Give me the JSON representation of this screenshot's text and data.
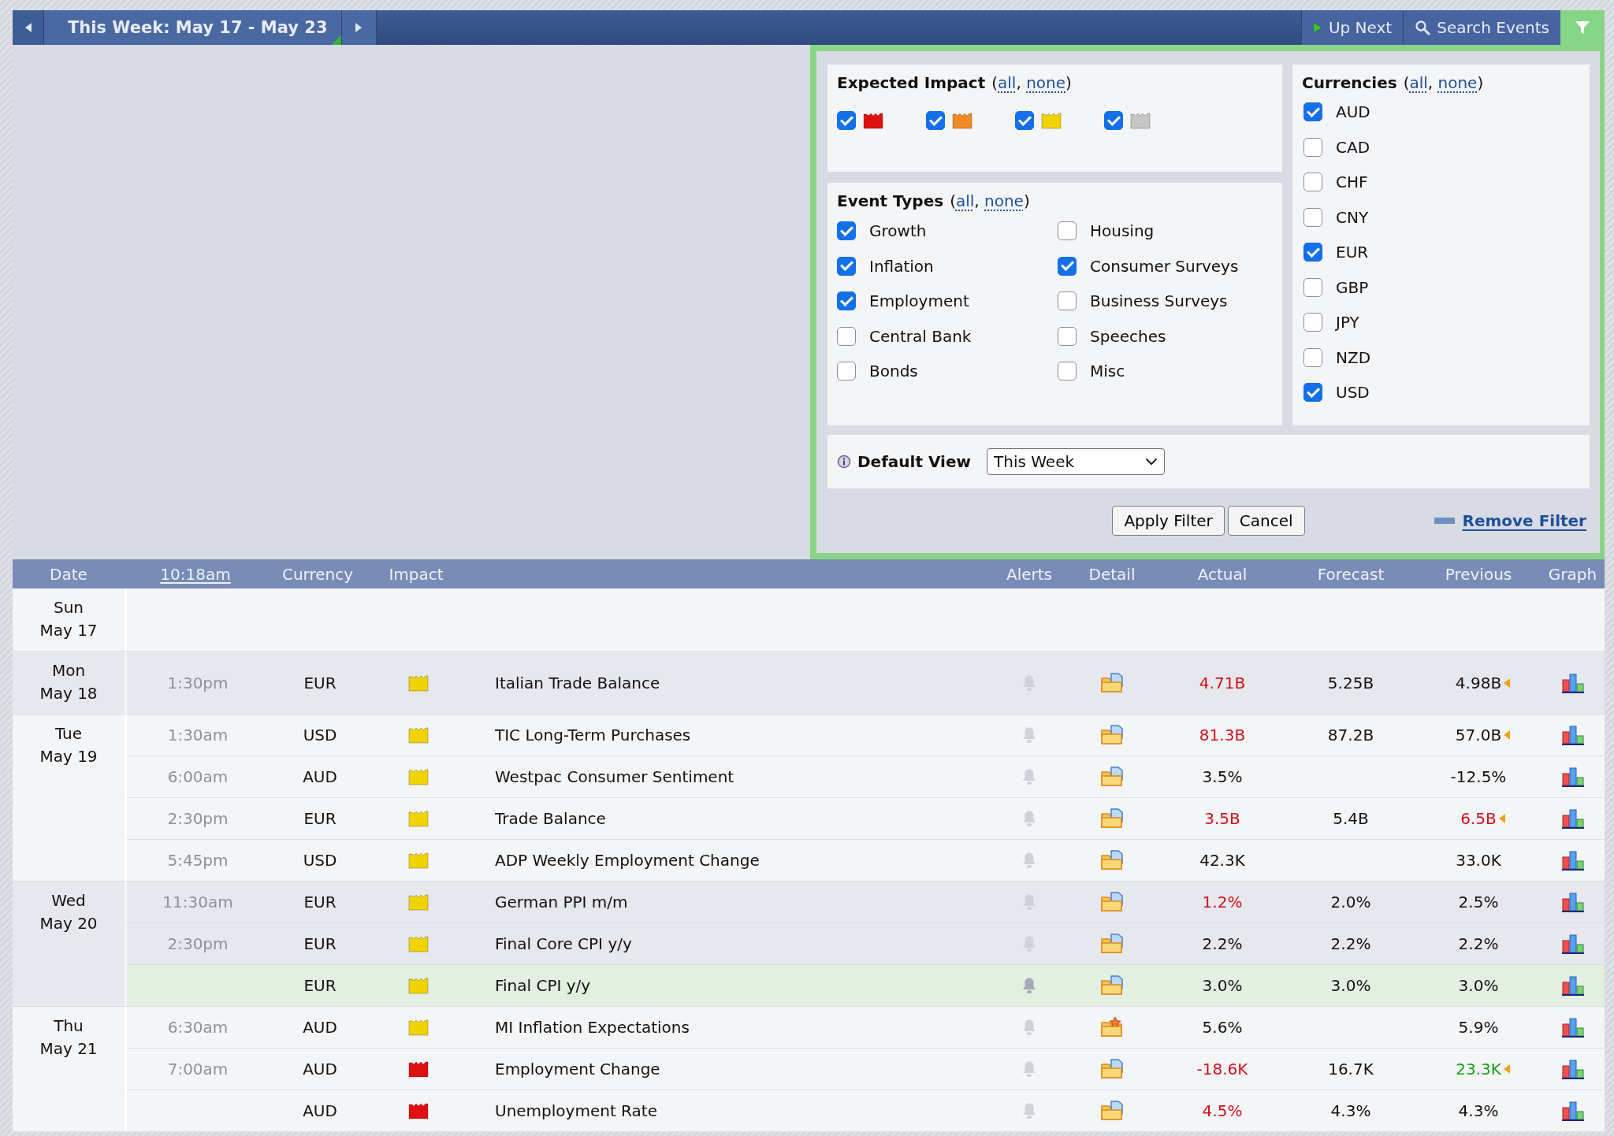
{
  "toolbar": {
    "period": "This Week: May 17 - May 23",
    "up_next": "Up Next",
    "search": "Search Events",
    "filter_active": true
  },
  "filter": {
    "impact": {
      "title": "Expected Impact",
      "open": "(",
      "all": "all",
      "separator": ",",
      "none": "none",
      "close": ")",
      "items": [
        {
          "color": "#e01010",
          "checked": true
        },
        {
          "color": "#f08a24",
          "checked": true
        },
        {
          "color": "#f0d400",
          "checked": true
        },
        {
          "color": "#c6c6c6",
          "checked": true
        }
      ]
    },
    "event_types": {
      "title": "Event Types",
      "open": "(",
      "all": "all",
      "separator": ",",
      "none": "none",
      "close": ")",
      "items": [
        {
          "label": "Growth",
          "checked": true
        },
        {
          "label": "Inflation",
          "checked": true
        },
        {
          "label": "Employment",
          "checked": true
        },
        {
          "label": "Central Bank",
          "checked": false
        },
        {
          "label": "Bonds",
          "checked": false
        },
        {
          "label": "Housing",
          "checked": false
        },
        {
          "label": "Consumer Surveys",
          "checked": true
        },
        {
          "label": "Business Surveys",
          "checked": false
        },
        {
          "label": "Speeches",
          "checked": false
        },
        {
          "label": "Misc",
          "checked": false
        }
      ]
    },
    "currencies": {
      "title": "Currencies",
      "open": "(",
      "all": "all",
      "separator": ",",
      "none": "none",
      "close": ")",
      "items": [
        {
          "label": "AUD",
          "checked": true
        },
        {
          "label": "CAD",
          "checked": false
        },
        {
          "label": "CHF",
          "checked": false
        },
        {
          "label": "CNY",
          "checked": false
        },
        {
          "label": "EUR",
          "checked": true
        },
        {
          "label": "GBP",
          "checked": false
        },
        {
          "label": "JPY",
          "checked": false
        },
        {
          "label": "NZD",
          "checked": false
        },
        {
          "label": "USD",
          "checked": true
        }
      ]
    },
    "default_view": {
      "label": "Default View",
      "value": "This Week"
    },
    "apply": "Apply Filter",
    "cancel": "Cancel",
    "remove": "Remove Filter"
  },
  "calendar": {
    "columns": {
      "date": "Date",
      "time": "10:18am",
      "currency": "Currency",
      "impact": "Impact",
      "alerts": "Alerts",
      "detail": "Detail",
      "actual": "Actual",
      "forecast": "Forecast",
      "previous": "Previous",
      "graph": "Graph"
    },
    "days": [
      {
        "day": "Sun",
        "date": "May 17"
      },
      {
        "day": "Mon",
        "date": "May 18",
        "events": [
          {
            "time": "1:30pm",
            "currency": "EUR",
            "color": "#f0d400",
            "title": "Italian Trade Balance",
            "kind": "document",
            "actual": "4.71B",
            "actual_worse": true,
            "actual_better": false,
            "forecast": "5.25B",
            "previous": "4.98B",
            "previous_worse": false,
            "previous_better": false,
            "revised": true,
            "upcoming": false
          }
        ]
      },
      {
        "day": "Tue",
        "date": "May 19",
        "events": [
          {
            "time": "1:30am",
            "currency": "USD",
            "color": "#f0d400",
            "title": "TIC Long-Term Purchases",
            "kind": "document",
            "actual": "81.3B",
            "actual_worse": true,
            "actual_better": false,
            "forecast": "87.2B",
            "previous": "57.0B",
            "previous_worse": false,
            "previous_better": false,
            "revised": true,
            "upcoming": false
          },
          {
            "time": "6:00am",
            "currency": "AUD",
            "color": "#f0d400",
            "title": "Westpac Consumer Sentiment",
            "kind": "document",
            "actual": "3.5%",
            "actual_worse": false,
            "actual_better": false,
            "previous": "-12.5%",
            "previous_worse": false,
            "previous_better": false,
            "revised": false,
            "upcoming": false
          },
          {
            "time": "2:30pm",
            "currency": "EUR",
            "color": "#f0d400",
            "title": "Trade Balance",
            "kind": "document",
            "actual": "3.5B",
            "actual_worse": true,
            "actual_better": false,
            "forecast": "5.4B",
            "previous": "6.5B",
            "previous_worse": true,
            "previous_better": false,
            "revised": true,
            "upcoming": false
          },
          {
            "time": "5:45pm",
            "currency": "USD",
            "color": "#f0d400",
            "title": "ADP Weekly Employment Change",
            "kind": "document",
            "actual": "42.3K",
            "actual_worse": false,
            "actual_better": false,
            "previous": "33.0K",
            "previous_worse": false,
            "previous_better": false,
            "revised": false,
            "upcoming": false
          }
        ]
      },
      {
        "day": "Wed",
        "date": "May 20",
        "events": [
          {
            "time": "11:30am",
            "currency": "EUR",
            "color": "#f0d400",
            "title": "German PPI m/m",
            "kind": "document",
            "actual": "1.2%",
            "actual_worse": true,
            "actual_better": false,
            "forecast": "2.0%",
            "previous": "2.5%",
            "previous_worse": false,
            "previous_better": false,
            "revised": false,
            "upcoming": false
          },
          {
            "time": "2:30pm",
            "currency": "EUR",
            "color": "#f0d400",
            "title": "Final Core CPI y/y",
            "kind": "document",
            "actual": "2.2%",
            "actual_worse": false,
            "actual_better": false,
            "forecast": "2.2%",
            "previous": "2.2%",
            "previous_worse": false,
            "previous_better": false,
            "revised": false,
            "upcoming": false
          },
          {
            "currency": "EUR",
            "color": "#f0d400",
            "title": "Final CPI y/y",
            "kind": "document",
            "actual": "3.0%",
            "actual_worse": false,
            "actual_better": false,
            "forecast": "3.0%",
            "previous": "3.0%",
            "previous_worse": false,
            "previous_better": false,
            "revised": false,
            "upcoming": true
          }
        ]
      },
      {
        "day": "Thu",
        "date": "May 21",
        "events": [
          {
            "time": "6:30am",
            "currency": "AUD",
            "color": "#f0d400",
            "title": "MI Inflation Expectations",
            "kind": "star",
            "actual": "5.6%",
            "actual_worse": false,
            "actual_better": false,
            "previous": "5.9%",
            "previous_worse": false,
            "previous_better": false,
            "revised": false,
            "upcoming": false
          },
          {
            "time": "7:00am",
            "currency": "AUD",
            "color": "#e01010",
            "title": "Employment Change",
            "kind": "document",
            "actual": "-18.6K",
            "actual_worse": true,
            "actual_better": false,
            "forecast": "16.7K",
            "previous": "23.3K",
            "previous_worse": false,
            "previous_better": true,
            "revised": true,
            "upcoming": false
          },
          {
            "currency": "AUD",
            "color": "#e01010",
            "title": "Unemployment Rate",
            "kind": "document",
            "actual": "4.5%",
            "actual_worse": true,
            "actual_better": false,
            "forecast": "4.3%",
            "previous": "4.3%",
            "previous_worse": false,
            "previous_better": false,
            "revised": false,
            "upcoming": false
          }
        ]
      }
    ]
  }
}
